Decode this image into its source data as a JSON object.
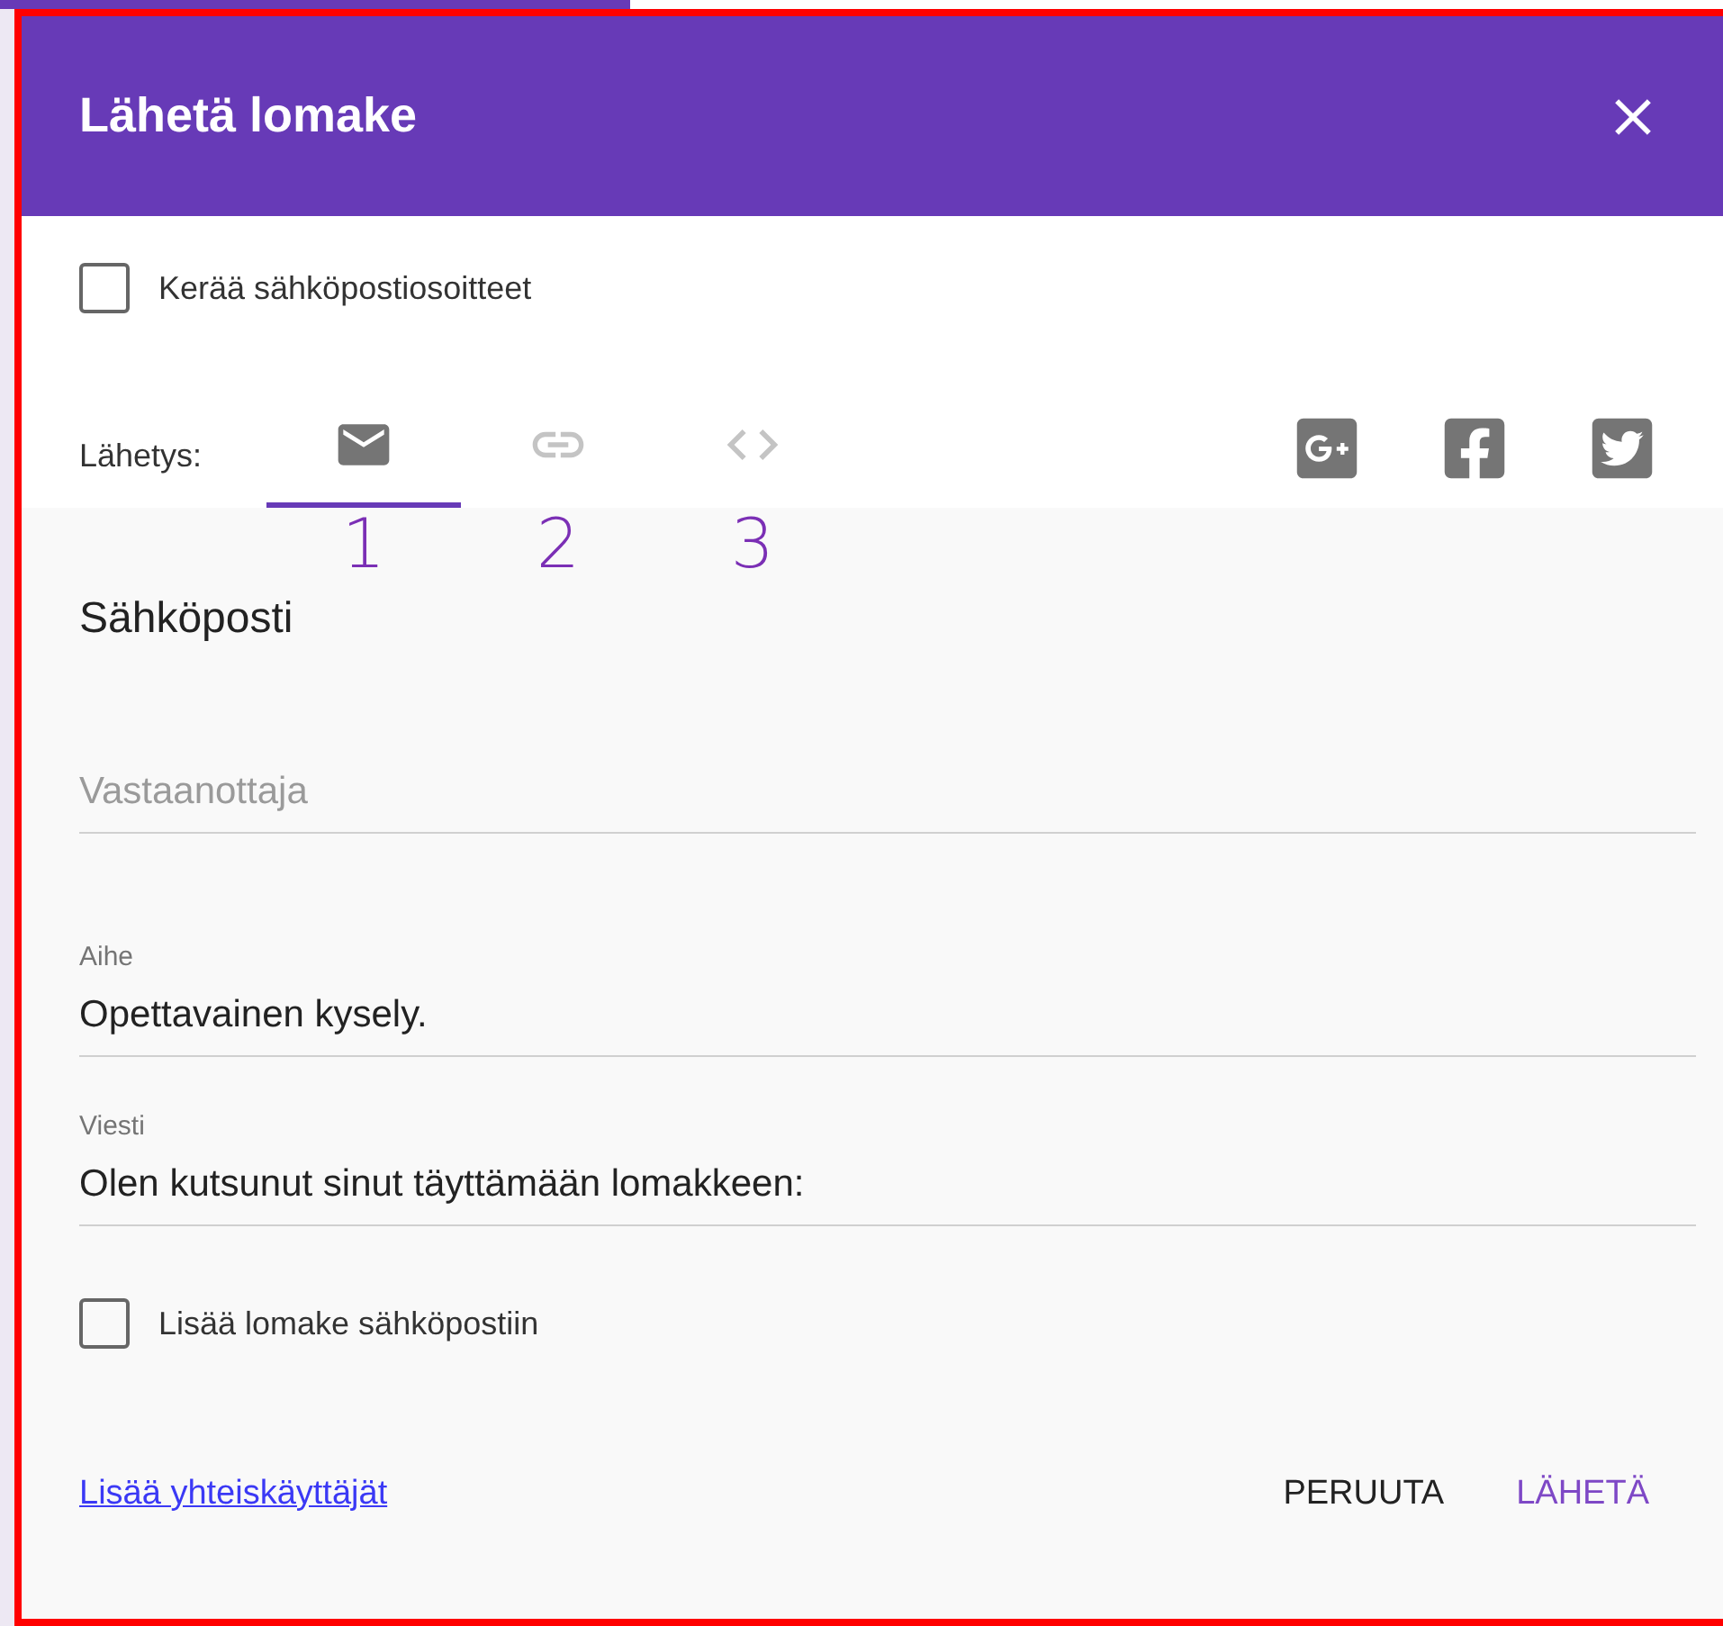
{
  "dialog": {
    "title": "Lähetä lomake"
  },
  "collect_emails": {
    "label": "Kerää sähköpostiosoitteet",
    "checked": false
  },
  "send_via": {
    "label": "Lähetys:",
    "tabs": [
      {
        "kind": "email",
        "selected": true,
        "annotation": "1"
      },
      {
        "kind": "link",
        "selected": false,
        "annotation": "2"
      },
      {
        "kind": "embed",
        "selected": false,
        "annotation": "3"
      }
    ],
    "social": [
      {
        "kind": "googleplus"
      },
      {
        "kind": "facebook"
      },
      {
        "kind": "twitter"
      }
    ]
  },
  "section_title": "Sähköposti",
  "fields": [
    {
      "placeholder": "Vastaanottaja"
    },
    {
      "label": "Aihe",
      "value": "Opettavainen kysely."
    },
    {
      "label": "Viesti",
      "value": "Olen kutsunut sinut täyttämään lomakkeen:"
    }
  ],
  "include_form": {
    "label": "Lisää lomake sähköpostiin",
    "checked": false
  },
  "footer": {
    "link": "Lisää yhteiskäyttäjät",
    "buttons": [
      {
        "label": "PERUUTA",
        "kind": "cancel"
      },
      {
        "label": "LÄHETÄ",
        "kind": "primary"
      }
    ]
  }
}
